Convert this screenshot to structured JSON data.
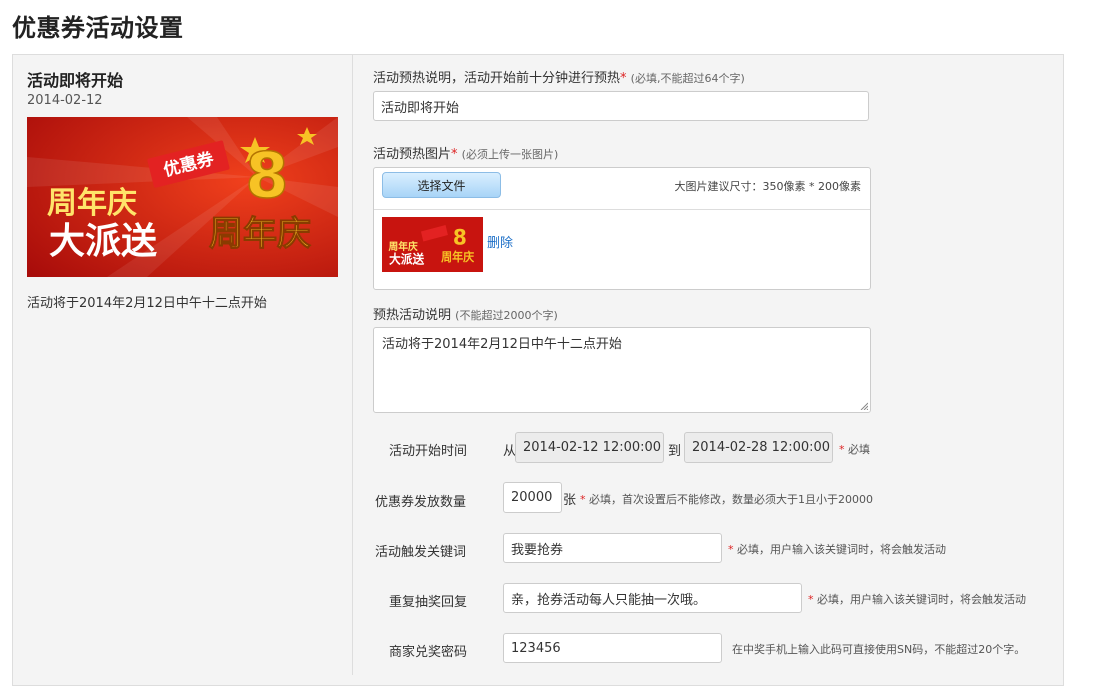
{
  "page": {
    "title": "优惠券活动设置"
  },
  "preview": {
    "title": "活动即将开始",
    "date": "2014-02-12",
    "banner": {
      "badge": "优惠券",
      "line1": "周年庆",
      "line2": "大派送",
      "digit": "8",
      "right_text": "周年庆"
    },
    "description": "活动将于2014年2月12日中午十二点开始"
  },
  "form": {
    "warmup_desc": {
      "label": "活动预热说明，活动开始前十分钟进行预热",
      "required_mark": "*",
      "hint": "(必填,不能超过64个字)",
      "value": "活动即将开始"
    },
    "warmup_image": {
      "label": "活动预热图片",
      "required_mark": "*",
      "hint": "(必须上传一张图片)",
      "choose_button": "选择文件",
      "size_hint": "大图片建议尺寸：350像素 * 200像素",
      "delete_label": "删除"
    },
    "warmup_activity_desc": {
      "label": "预热活动说明",
      "hint": "(不能超过2000个字)",
      "value": "活动将于2014年2月12日中午十二点开始"
    },
    "start_time": {
      "label": "活动开始时间",
      "from_label": "从",
      "from_value": "2014-02-12 12:00:00",
      "to_label": "到",
      "to_value": "2014-02-28 12:00:00",
      "required_mark": "*",
      "required_text": "必填"
    },
    "coupon_count": {
      "label": "优惠券发放数量",
      "value": "20000",
      "unit": "张",
      "required_mark": "*",
      "hint": "必填，首次设置后不能修改，数量必须大于1且小于20000"
    },
    "keyword": {
      "label": "活动触发关键词",
      "value": "我要抢券",
      "required_mark": "*",
      "hint": "必填，用户输入该关键词时，将会触发活动"
    },
    "repeat_reply": {
      "label": "重复抽奖回复",
      "value": "亲，抢券活动每人只能抽一次哦。",
      "required_mark": "*",
      "hint": "必填，用户输入该关键词时，将会触发活动"
    },
    "merchant_password": {
      "label": "商家兑奖密码",
      "value": "123456",
      "hint": "在中奖手机上输入此码可直接使用SN码，不能超过20个字。"
    }
  },
  "colors": {
    "required": "#d22222",
    "link": "#1e70c8",
    "panel_bg": "#f4f4f4",
    "banner_red": "#c8140f",
    "banner_gold": "#f7c325"
  },
  "icons": {
    "resize": "resize-grip-icon"
  }
}
